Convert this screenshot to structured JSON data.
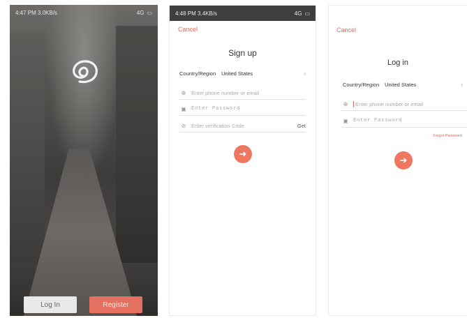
{
  "splash": {
    "status": {
      "time": "4:47 PM",
      "net": "3.0KB/s",
      "signal": "4G"
    },
    "buttons": {
      "login": "Log In",
      "register": "Register"
    }
  },
  "signup": {
    "status": {
      "time": "4:48 PM",
      "net": "3.4KB/s",
      "signal": "4G"
    },
    "cancel": "Cancel",
    "title": "Sign up",
    "region_label": "Country/Region",
    "region_value": "United States",
    "phone_placeholder": "Enter phone number or email",
    "password_placeholder": "Enter Password",
    "code_placeholder": "Enter verification Code",
    "get_code": "Get",
    "submit_icon": "arrow-right-icon"
  },
  "login": {
    "cancel": "Cancel",
    "title": "Log in",
    "region_label": "Country/Region",
    "region_value": "United States",
    "phone_placeholder": "Enter phone number or email",
    "password_placeholder": "Enter Password",
    "forgot": "Forgot Password",
    "submit_icon": "arrow-right-icon"
  },
  "colors": {
    "accent": "#ee7760",
    "cancel": "#ea6a58"
  }
}
